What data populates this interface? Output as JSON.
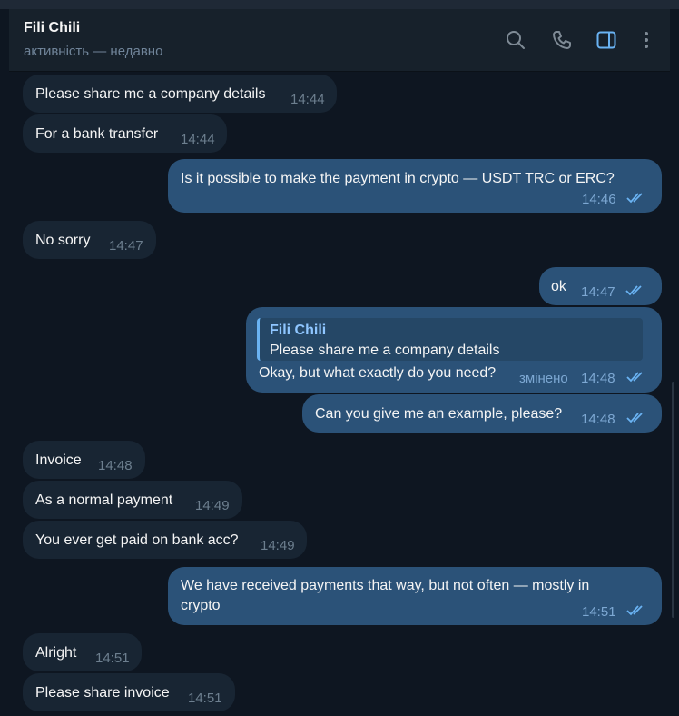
{
  "header": {
    "name": "Fili Chili",
    "status": "активність — недавно"
  },
  "messages": [
    {
      "dir": "in",
      "text": "Please share me a company details",
      "time": "14:44"
    },
    {
      "dir": "in",
      "text": "For a bank transfer",
      "time": "14:44"
    },
    {
      "dir": "out",
      "text": "Is it possible to make the payment in crypto — USDT TRC or ERC?",
      "time": "14:46",
      "read": true
    },
    {
      "dir": "in",
      "text": "No sorry",
      "time": "14:47"
    },
    {
      "dir": "out",
      "text": "ok",
      "time": "14:47",
      "read": true
    },
    {
      "dir": "out",
      "reply_name": "Fili Chili",
      "reply_text": "Please share me a company details",
      "text": "Okay, but what exactly do you need?",
      "edited": "змінено",
      "time": "14:48",
      "read": true
    },
    {
      "dir": "out",
      "text": "Can you give me an example, please?",
      "time": "14:48",
      "read": true
    },
    {
      "dir": "in",
      "text": "Invoice",
      "time": "14:48"
    },
    {
      "dir": "in",
      "text": "As a normal payment",
      "time": "14:49"
    },
    {
      "dir": "in",
      "text": "You ever get paid on bank acc?",
      "time": "14:49"
    },
    {
      "dir": "out",
      "text_line1": "We have received payments that way, but not often — mostly in",
      "text_line2": "crypto",
      "time": "14:51",
      "read": true
    },
    {
      "dir": "in",
      "text": "Alright",
      "time": "14:51"
    },
    {
      "dir": "in",
      "text": "Please share invoice",
      "time": "14:51"
    }
  ]
}
